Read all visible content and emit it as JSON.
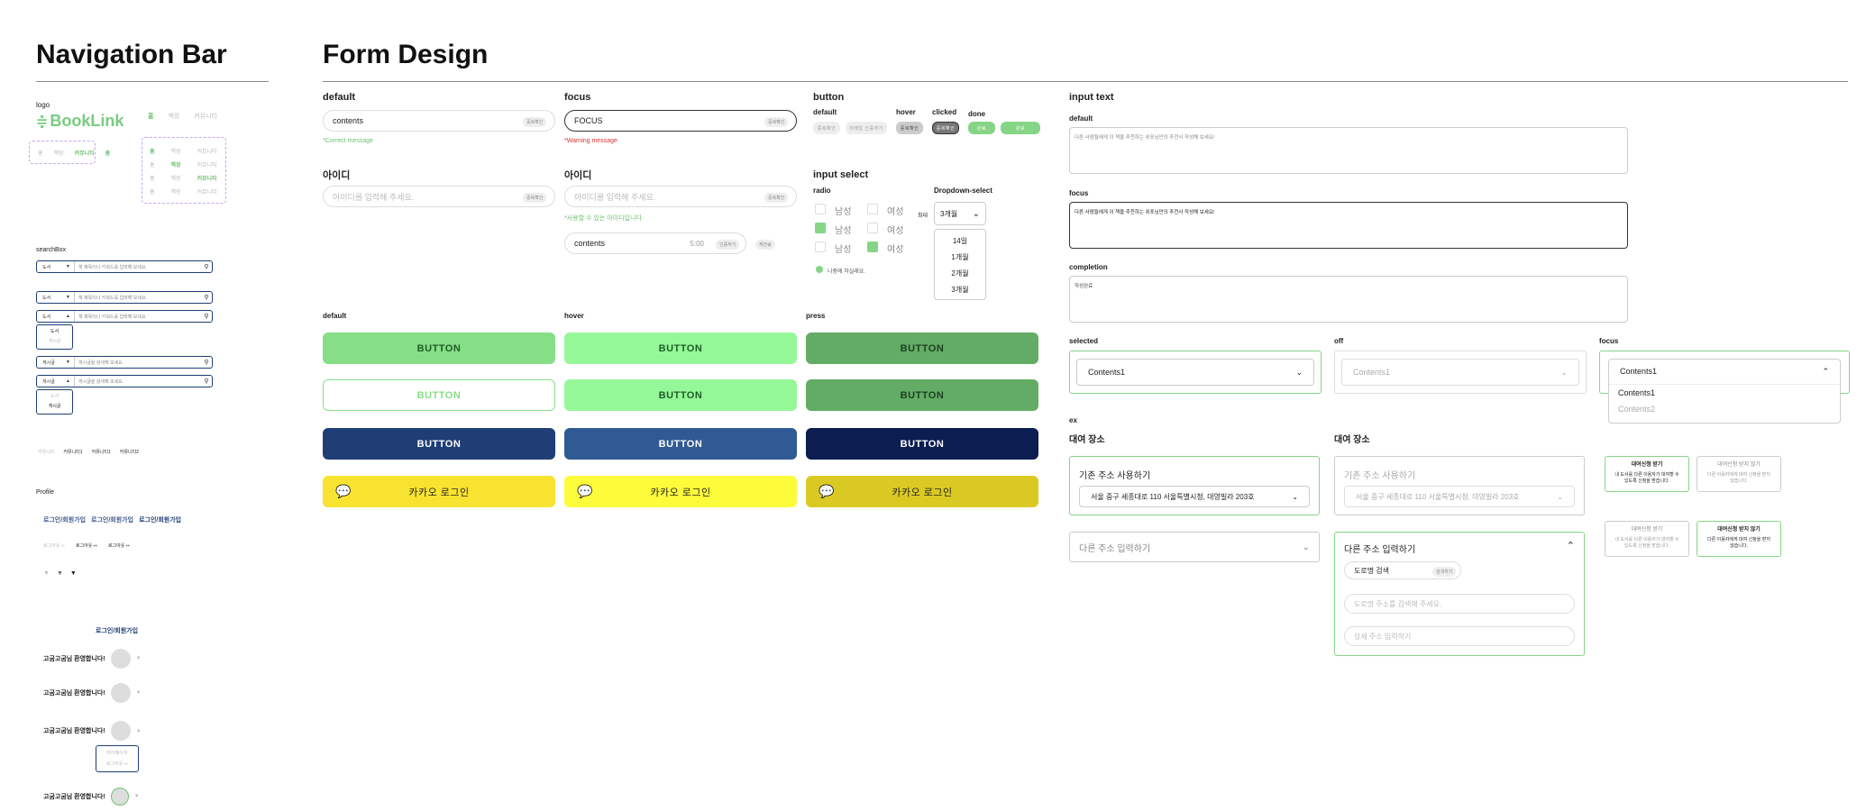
{
  "nav": {
    "title": "Navigation Bar",
    "logo_label": "logo",
    "logo_text": "BookLink",
    "tabs": [
      "홈",
      "책장",
      "커뮤니티"
    ],
    "small_tabs": [
      "홈",
      "책장",
      "커뮤니티",
      "홈"
    ],
    "grid": [
      [
        "홈",
        "책장",
        "커뮤니티"
      ],
      [
        "홈",
        "책장",
        "커뮤니티"
      ],
      [
        "홈",
        "책장",
        "커뮤니티"
      ],
      [
        "홈",
        "책장",
        "커뮤니티"
      ]
    ],
    "searchbox_label": "searchBox",
    "search_rows": [
      {
        "select": "도서",
        "ph": "책 제목이나 키워드를 입력해 보세요."
      },
      {
        "select": "도서",
        "ph": "책 제목이나 키워드를 입력해 보세요."
      },
      {
        "select": "도서",
        "ph": "책 제목이나 키워드를 입력해 보세요."
      },
      {
        "select": "게시글",
        "ph": "게시글을 검색해 보세요."
      },
      {
        "select": "게시글",
        "ph": "게시글을 검색해 보세요."
      }
    ],
    "search_dd1": [
      "도서",
      "게시글"
    ],
    "search_dd2": [
      "도서",
      "게시글"
    ],
    "pagination": [
      "커뮤니티",
      "커뮤니티1",
      "커뮤니티1",
      "커뮤니티2"
    ],
    "profile_label": "Profile",
    "login_links": [
      "로그인/회원가입",
      "로그인/회원가입",
      "로그인/회원가입"
    ],
    "logout_items": [
      "로그아웃",
      "로그아웃",
      "로그아웃"
    ],
    "login_center": "로그인/회원가입",
    "welcome": "고굼고굼님 환영합니다!",
    "profile_menu": [
      "마이페이지",
      "로그아웃"
    ]
  },
  "form": {
    "title": "Form Design",
    "default_label": "default",
    "focus_label": "focus",
    "contents": "contents",
    "focus_value": "FOCUS",
    "chip_confirm": "중복확인",
    "correct_msg": "*Correct message",
    "warning_msg": "*Warning message",
    "id_label": "아이디",
    "id_placeholder": "아이디를 입력해 주세요.",
    "id_ok_msg": "*사용할 수 있는 아이디입니다.",
    "timer": "5:00",
    "chip_verify": "인증하기",
    "chip_resend": "재전송",
    "button_label": "button",
    "btn_states": [
      "default",
      "hover",
      "clicked",
      "done"
    ],
    "btn_small": [
      "중복확인",
      "이메일 인증하기",
      "중복확인",
      "중복확인",
      "완료",
      "완료"
    ],
    "input_select_label": "input select",
    "radio_label": "radio",
    "radio_opts": [
      "남성",
      "여성"
    ],
    "agree_text": "나중에 하실래요.",
    "dropdown_label": "Dropdown-select",
    "dropdown_prefix": "최대",
    "dropdown_value": "3개월",
    "dropdown_opts": [
      "14일",
      "1개월",
      "2개월",
      "3개월"
    ],
    "bigbtn_states": [
      "default",
      "hover",
      "press"
    ],
    "button_text": "BUTTON",
    "kakao_text": "카카오 로그인",
    "input_text_label": "input text",
    "ta_labels": [
      "default",
      "focus",
      "completion"
    ],
    "ta_texts": [
      "다른 사람들에게 이 책을 추천하는 위포님만의 추천사 작성해 보세요!",
      "다른 사람들에게 이 책을 추천하는 위포님만의 추천사 작성해 보세요!",
      "작성완료"
    ],
    "sel_labels": [
      "selected",
      "off",
      "focus"
    ],
    "sel_value": "Contents1",
    "sel_opts": [
      "Contents1",
      "Contents2"
    ],
    "ex_label": "ex",
    "rent_label": "대여 장소",
    "use_addr": "기존 주소 사용하기",
    "addr": "서울 중구 세종대로 110 서울특별시청, 대영빌라 203호",
    "other_addr": "다른 주소 입력하기",
    "road_search": "도로명 검색",
    "road_chip": "검색하기",
    "road_ph": "도로명 주소를 검색해 주세요.",
    "detail_ph": "상세 주소 입력하기",
    "cards": [
      {
        "t": "대여신청 받기",
        "d": "내 도서를 다른 이용자가 대여할 수 있도록 신청을 받습니다."
      },
      {
        "t": "대여신청 받지 않기",
        "d": "다른 이용자에게 대여 신청을 받지 않습니다."
      },
      {
        "t": "대여신청 받기",
        "d": "내 도서를 다른 이용자가 대여할 수 있도록 신청을 받습니다."
      },
      {
        "t": "대여신청 받지 않기",
        "d": "다른 이용자에게 대여 신청을 받지 않습니다."
      }
    ]
  }
}
